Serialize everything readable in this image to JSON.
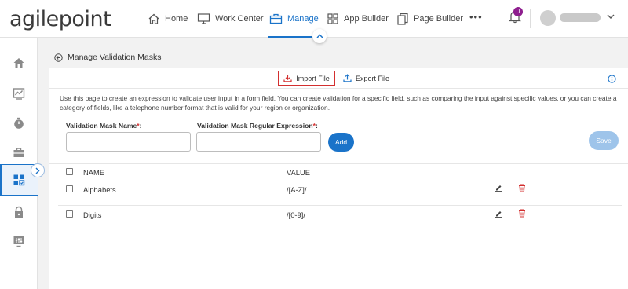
{
  "brand": {
    "logo_text": "agilepoint"
  },
  "nav": {
    "items": [
      {
        "label": "Home",
        "icon": "home-icon"
      },
      {
        "label": "Work Center",
        "icon": "monitor-icon"
      },
      {
        "label": "Manage",
        "icon": "briefcase-icon",
        "active": true
      },
      {
        "label": "App Builder",
        "icon": "grid-icon"
      },
      {
        "label": "Page Builder",
        "icon": "pages-icon"
      }
    ],
    "more": "•••",
    "notification_count": "0",
    "accent_color": "#1a73c9"
  },
  "sidebar": {
    "items": [
      "home-icon",
      "chart-icon",
      "timer-icon",
      "toolbox-icon",
      "apps-icon",
      "lock-icon",
      "equalizer-icon"
    ],
    "active_index": 4
  },
  "page": {
    "title": "Manage Validation Masks",
    "import_label": "Import File",
    "export_label": "Export File",
    "description": "Use this page to create an expression to validate user input in a form field. You can create validation for a specific field, such as comparing the input against specific values, or you can create a category of fields, like a telephone number format that is valid for your region or organization.",
    "form": {
      "name_label": "Validation Mask Name",
      "regex_label": "Validation Mask Regular Expression",
      "required_mark": "*",
      "colon": ":",
      "name_value": "",
      "regex_value": "",
      "add_label": "Add",
      "save_label": "Save"
    },
    "table": {
      "columns": [
        "NAME",
        "VALUE"
      ],
      "rows": [
        {
          "name": "Alphabets",
          "value": "/[A-Z]/"
        },
        {
          "name": "Digits",
          "value": "/[0-9]/"
        }
      ]
    }
  }
}
